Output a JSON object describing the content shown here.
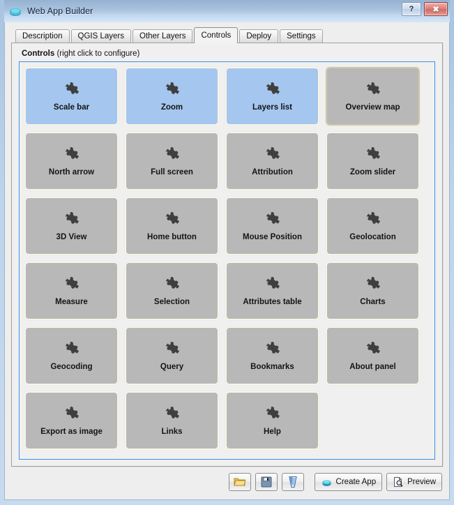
{
  "window": {
    "title": "Web App Builder",
    "icon": "app-diamond-icon",
    "buttons": [
      {
        "name": "help-button",
        "label": "?"
      },
      {
        "name": "close-button",
        "label": "✖"
      }
    ]
  },
  "tabs": [
    {
      "label": "Description",
      "active": false
    },
    {
      "label": "QGIS Layers",
      "active": false
    },
    {
      "label": "Other Layers",
      "active": false
    },
    {
      "label": "Controls",
      "active": true
    },
    {
      "label": "Deploy",
      "active": false
    },
    {
      "label": "Settings",
      "active": false
    }
  ],
  "group": {
    "title": "Controls",
    "hint": " (right click to configure)"
  },
  "colors": {
    "selected_tile": "#a4c6ef",
    "unselected_tile": "#b8b8b8",
    "tile_border": "#f7f5e6",
    "focus_border": "#cfc9a6",
    "scrollarea_border": "#3b92e0",
    "accent": "#3b92e0",
    "titlebar_top": "#96b2d2",
    "titlebar_bottom": "#d6e6f7",
    "close_button": "#d06a66",
    "create_app_icon": "#37c6d4"
  },
  "controls": [
    {
      "label": "Scale bar",
      "selected": true,
      "focused": false,
      "icon": "puzzle-piece-icon"
    },
    {
      "label": "Zoom",
      "selected": true,
      "focused": false,
      "icon": "puzzle-piece-icon"
    },
    {
      "label": "Layers list",
      "selected": true,
      "focused": false,
      "icon": "puzzle-piece-icon"
    },
    {
      "label": "Overview map",
      "selected": false,
      "focused": true,
      "icon": "puzzle-piece-icon"
    },
    {
      "label": "North arrow",
      "selected": false,
      "focused": false,
      "icon": "puzzle-piece-icon"
    },
    {
      "label": "Full screen",
      "selected": false,
      "focused": false,
      "icon": "puzzle-piece-icon"
    },
    {
      "label": "Attribution",
      "selected": false,
      "focused": false,
      "icon": "puzzle-piece-icon"
    },
    {
      "label": "Zoom slider",
      "selected": false,
      "focused": false,
      "icon": "puzzle-piece-icon"
    },
    {
      "label": "3D View",
      "selected": false,
      "focused": false,
      "icon": "puzzle-piece-icon"
    },
    {
      "label": "Home button",
      "selected": false,
      "focused": false,
      "icon": "puzzle-piece-icon"
    },
    {
      "label": "Mouse Position",
      "selected": false,
      "focused": false,
      "icon": "puzzle-piece-icon"
    },
    {
      "label": "Geolocation",
      "selected": false,
      "focused": false,
      "icon": "puzzle-piece-icon"
    },
    {
      "label": "Measure",
      "selected": false,
      "focused": false,
      "icon": "puzzle-piece-icon"
    },
    {
      "label": "Selection",
      "selected": false,
      "focused": false,
      "icon": "puzzle-piece-icon"
    },
    {
      "label": "Attributes table",
      "selected": false,
      "focused": false,
      "icon": "puzzle-piece-icon"
    },
    {
      "label": "Charts",
      "selected": false,
      "focused": false,
      "icon": "puzzle-piece-icon"
    },
    {
      "label": "Geocoding",
      "selected": false,
      "focused": false,
      "icon": "puzzle-piece-icon"
    },
    {
      "label": "Query",
      "selected": false,
      "focused": false,
      "icon": "puzzle-piece-icon"
    },
    {
      "label": "Bookmarks",
      "selected": false,
      "focused": false,
      "icon": "puzzle-piece-icon"
    },
    {
      "label": "About panel",
      "selected": false,
      "focused": false,
      "icon": "puzzle-piece-icon"
    },
    {
      "label": "Export as image",
      "selected": false,
      "focused": false,
      "icon": "puzzle-piece-icon"
    },
    {
      "label": "Links",
      "selected": false,
      "focused": false,
      "icon": "puzzle-piece-icon"
    },
    {
      "label": "Help",
      "selected": false,
      "focused": false,
      "icon": "puzzle-piece-icon"
    }
  ],
  "toolbar": [
    {
      "name": "open-project-button",
      "label": "",
      "icon": "folder-open-icon"
    },
    {
      "name": "save-project-button",
      "label": "",
      "icon": "floppy-disk-icon"
    },
    {
      "name": "qgis-project-button",
      "label": "",
      "icon": "qgis-icon"
    },
    {
      "name": "create-app-button",
      "label": "Create App",
      "icon": "diamond-icon"
    },
    {
      "name": "preview-button",
      "label": "Preview",
      "icon": "page-magnifier-icon"
    }
  ]
}
